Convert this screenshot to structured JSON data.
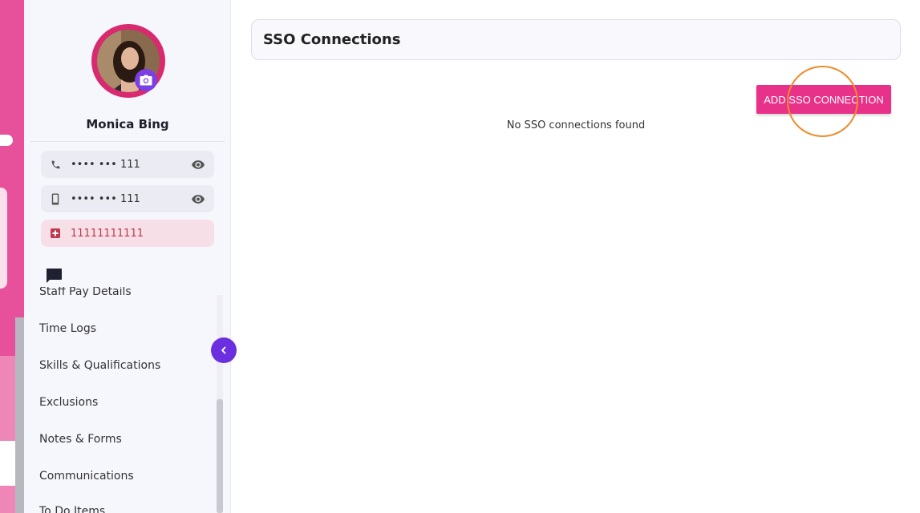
{
  "profile": {
    "name": "Monica Bing",
    "phone": "•••• ••• 111",
    "mobile": "•••• ••• 111",
    "emergency": "11111111111"
  },
  "nav": {
    "items": [
      {
        "label": "Staff Pay Details"
      },
      {
        "label": "Time Logs"
      },
      {
        "label": "Skills & Qualifications"
      },
      {
        "label": "Exclusions"
      },
      {
        "label": "Notes & Forms"
      },
      {
        "label": "Communications"
      },
      {
        "label": "To Do Items"
      }
    ]
  },
  "main": {
    "title": "SSO Connections",
    "add_button": "ADD SSO CONNECTION",
    "empty_message": "No SSO connections found"
  },
  "colors": {
    "accent_pink": "#e8328a",
    "accent_purple": "#6b2fe0",
    "click_indicator": "#f08a2a"
  },
  "icons": {
    "phone": "phone-icon",
    "mobile": "mobile-icon",
    "visibility": "eye-icon",
    "emergency": "medical-cross-icon",
    "chat": "chat-bubble-icon",
    "camera": "camera-icon",
    "collapse": "chevron-left-icon"
  }
}
